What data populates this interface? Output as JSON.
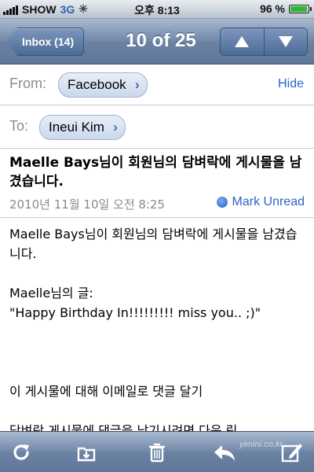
{
  "status_bar": {
    "carrier": "SHOW",
    "network": "3G",
    "time": "오후 8:13",
    "battery_percent": "96 %",
    "battery_level": 0.96
  },
  "nav": {
    "back_label": "Inbox (14)",
    "title": "10 of 25",
    "prev_icon": "up-arrow-icon",
    "next_icon": "down-arrow-icon"
  },
  "header": {
    "from_label": "From:",
    "from_name": "Facebook",
    "hide_label": "Hide",
    "to_label": "To:",
    "to_name": "Ineui Kim"
  },
  "subject": {
    "sender": "Maelle Bays",
    "text": "님이 회원님의 담벼락에 게시물을 남겼습니다.",
    "date": "2010년 11월 10일 오전 8:25",
    "mark_unread": "Mark Unread"
  },
  "body": {
    "line1": "Maelle Bays님이 회원님의 담벼락에 게시물을 남겼습니다.",
    "line2": "Maelle님의 글:",
    "line3": "\"Happy Birthday In!!!!!!!!! miss you.. ;)\"",
    "line4": "이 게시물에 대해 이메일로 댓글 달기",
    "line5": "담벼락 게시물에 댓글을 남기시려면 다음 링"
  },
  "toolbar": {
    "refresh_icon": "refresh-icon",
    "move_icon": "folder-move-icon",
    "trash_icon": "trash-icon",
    "reply_icon": "reply-icon",
    "compose_icon": "compose-icon",
    "watermark": "yimini.co.kr"
  },
  "colors": {
    "nav_blue": "#6b82a3",
    "link_blue": "#2a63c9",
    "label_gray": "#8c8c8c"
  }
}
